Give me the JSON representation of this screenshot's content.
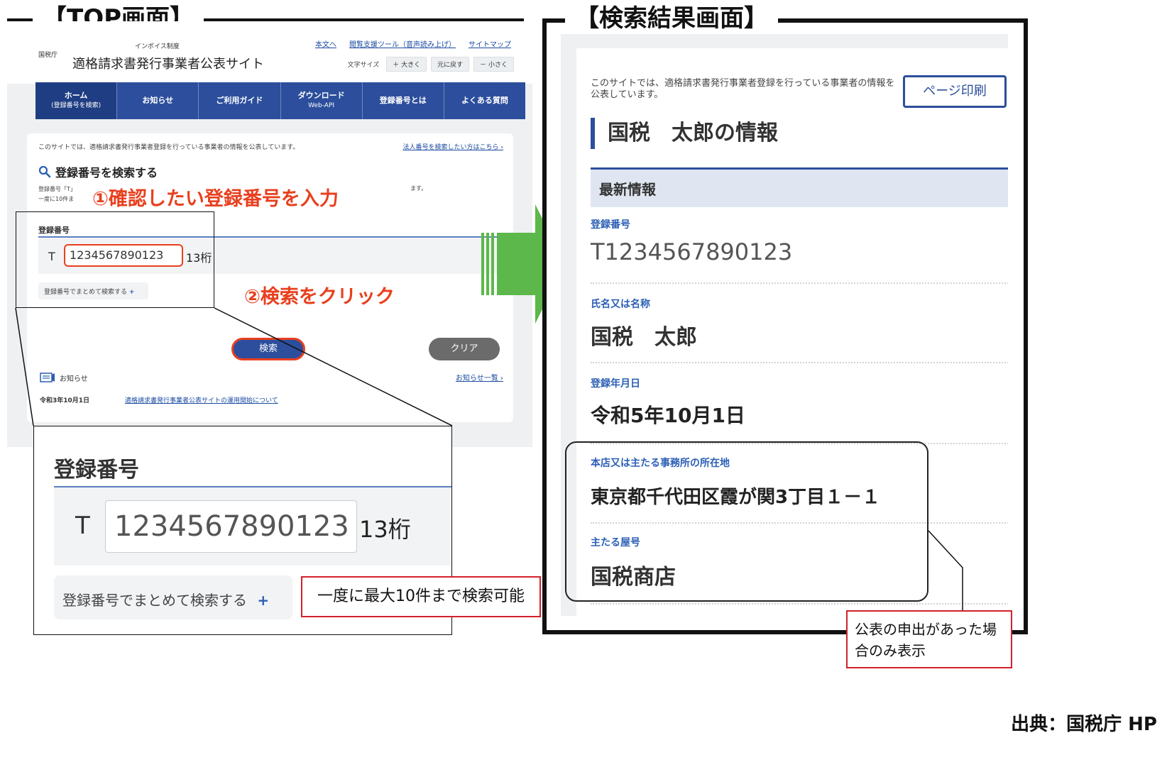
{
  "top_panel": {
    "title": "【TOP画面】",
    "agency": "国税庁",
    "site_sub": "インボイス制度",
    "site_title": "適格請求書発行事業者公表サイト",
    "header_links": [
      "本文へ",
      "閲覧支援ツール（音声読み上げ）",
      "サイトマップ"
    ],
    "font_size_label": "文字サイズ",
    "font_buttons": [
      "＋ 大きく",
      "元に戻す",
      "－ 小さく"
    ],
    "nav": [
      {
        "label": "ホーム",
        "sub": "(登録番号を検索)"
      },
      {
        "label": "お知らせ",
        "sub": ""
      },
      {
        "label": "ご利用ガイド",
        "sub": ""
      },
      {
        "label": "ダウンロード",
        "sub": "Web-API"
      },
      {
        "label": "登録番号とは",
        "sub": ""
      },
      {
        "label": "よくある質問",
        "sub": ""
      }
    ],
    "intro": "このサイトでは、適格請求書発行事業者登録を行っている事業者の情報を公表しています。",
    "intro_link": "法人番号を検索したい方はこちら ›",
    "search_heading": "登録番号を検索する",
    "note_line1": "登録番号「T」",
    "note_line2": "一度に10件ま",
    "note_right": "ます。",
    "step1": "①確認したい登録番号を入力",
    "field_label": "登録番号",
    "t_prefix": "T",
    "reg_number": "1234567890123",
    "digits": "13桁",
    "bulk_label": "登録番号でまとめて検索する",
    "plus": "+",
    "step2": "②検索をクリック",
    "search_btn": "検索",
    "clear_btn": "クリア",
    "news_heading": "お知らせ",
    "news_all": "お知らせ一覧 ›",
    "news_date": "令和3年10月1日",
    "news_link": "適格請求書発行事業者公表サイトの運用開始について"
  },
  "zoom": {
    "label": "登録番号",
    "t_prefix": "T",
    "reg_number": "1234567890123",
    "digits": "13桁",
    "bulk_label": "登録番号でまとめて検索する",
    "plus": "+",
    "note": "一度に最大10件まで検索可能"
  },
  "result_panel": {
    "title": "【検索結果画面】",
    "intro": "このサイトでは、適格請求書発行事業者登録を行っている事業者の情報を公表しています。",
    "print_btn": "ページ印刷",
    "name_heading": "国税　太郎の情報",
    "latest": "最新情報",
    "fields": [
      {
        "label": "登録番号",
        "value": "T1234567890123"
      },
      {
        "label": "氏名又は名称",
        "value": "国税　太郎"
      },
      {
        "label": "登録年月日",
        "value": "令和5年10月1日"
      },
      {
        "label": "本店又は主たる事務所の所在地",
        "value": "東京都千代田区霞が関3丁目１－１"
      },
      {
        "label": "主たる屋号",
        "value": "国税商店"
      }
    ],
    "pub_note": "公表の申出があった場合のみ表示"
  },
  "source": "出典：国税庁 HP",
  "colors": {
    "nav_blue": "#2c4e9c",
    "annotation_red": "#e8401f",
    "arrow_green": "#5cb84a"
  }
}
